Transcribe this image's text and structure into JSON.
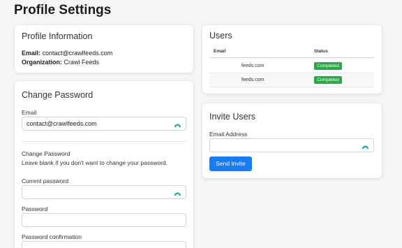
{
  "page": {
    "title": "Profile Settings"
  },
  "profile_info": {
    "title": "Profile Information",
    "email_label": "Email:",
    "email_value": "contact@crawlfeeds.com",
    "org_label": "Organization:",
    "org_value": "Crawl Feeds"
  },
  "change_password": {
    "title": "Change Password",
    "email_label": "Email",
    "email_value": "contact@crawlfeeds.com",
    "section_heading": "Change Password",
    "help_text": "Leave blank if you don't want to change your password.",
    "current_password_label": "Current password",
    "current_password_value": "",
    "password_label": "Password",
    "password_value": "",
    "confirmation_label": "Password confirmation",
    "confirmation_value": ""
  },
  "users": {
    "title": "Users",
    "columns": [
      "Email",
      "Status"
    ],
    "rows": [
      {
        "email": "feeds.com",
        "status": "Completed"
      },
      {
        "email": "feeds.com",
        "status": "Completed"
      }
    ],
    "status_color": "#2aa845"
  },
  "invite_users": {
    "title": "Invite Users",
    "email_label": "Email Address",
    "email_value": "",
    "button_label": "Send Invite",
    "button_color": "#1a7cf0"
  },
  "icons": {
    "field_icon": "password-manager-icon",
    "field_icon_color": "#1ea89a"
  }
}
